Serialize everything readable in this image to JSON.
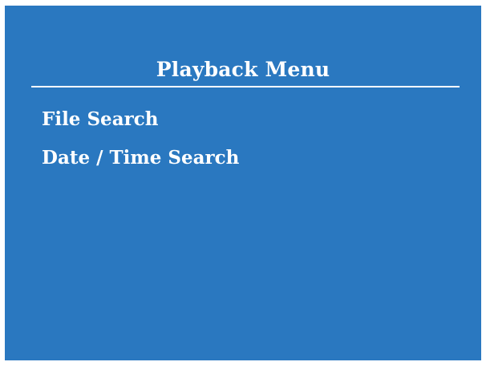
{
  "menu": {
    "title": "Playback Menu",
    "items": [
      {
        "label": "File Search"
      },
      {
        "label": "Date / Time Search"
      }
    ]
  },
  "colors": {
    "background": "#2a78c0",
    "text": "#ffffff"
  }
}
